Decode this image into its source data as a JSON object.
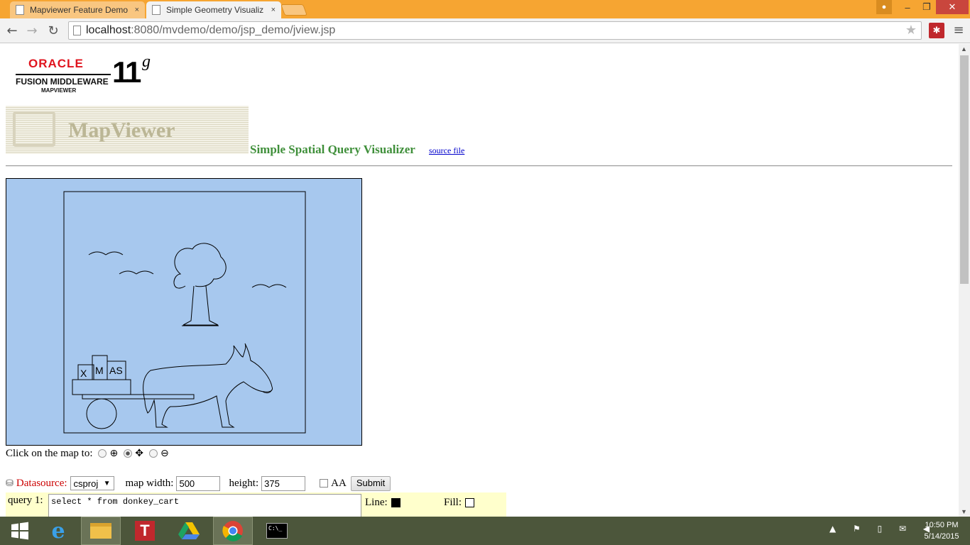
{
  "browser": {
    "tabs": [
      {
        "label": "Mapviewer Feature Demo",
        "active": false
      },
      {
        "label": "Simple Geometry Visualiz",
        "active": true
      }
    ],
    "tab_close": "×",
    "url_host": "localhost",
    "url_path": ":8080/mvdemo/demo/jsp_demo/jview.jsp",
    "icons": {
      "back": "←",
      "forward": "→",
      "reload": "↻",
      "star": "★",
      "menu": "≡",
      "extension": "✱",
      "min": "–",
      "max": "❐",
      "close": "✕",
      "user": "●"
    }
  },
  "logo": {
    "brand": "ORACLE",
    "line1": "FUSION MIDDLEWARE",
    "line2": "MAPVIEWER",
    "version": "11",
    "version_sup": "g",
    "banner_text": "MapViewer"
  },
  "page": {
    "title": "Simple Spatial Query Visualizer",
    "source_link": "source file",
    "click_label": "Click on the map to:",
    "zoom_in_icon": "⊕",
    "pan_icon": "✥",
    "zoom_out_icon": "⊖",
    "selected_mode": "pan"
  },
  "controls": {
    "datasource_label": "Datasource:",
    "datasource_value": "csproj",
    "dropdown_arrow": "▼",
    "map_width_label": "map width:",
    "map_width_value": "500",
    "height_label": "height:",
    "height_value": "375",
    "aa_label": "AA",
    "aa_checked": false,
    "submit_label": "Submit"
  },
  "query": {
    "label": "query 1:",
    "text": "select * from donkey_cart",
    "line_label": "Line:",
    "line_color": "#000000",
    "fill_label": "Fill:",
    "fill_color": "#ffffff"
  },
  "map": {
    "background": "#a7c8ee",
    "cart_letters": [
      "X",
      "M",
      "AS"
    ]
  },
  "taskbar": {
    "clock_time": "10:50 PM",
    "clock_date": "5/14/2015",
    "tray_icons": "▲ ⚑ ▯ ✉ ◀"
  }
}
